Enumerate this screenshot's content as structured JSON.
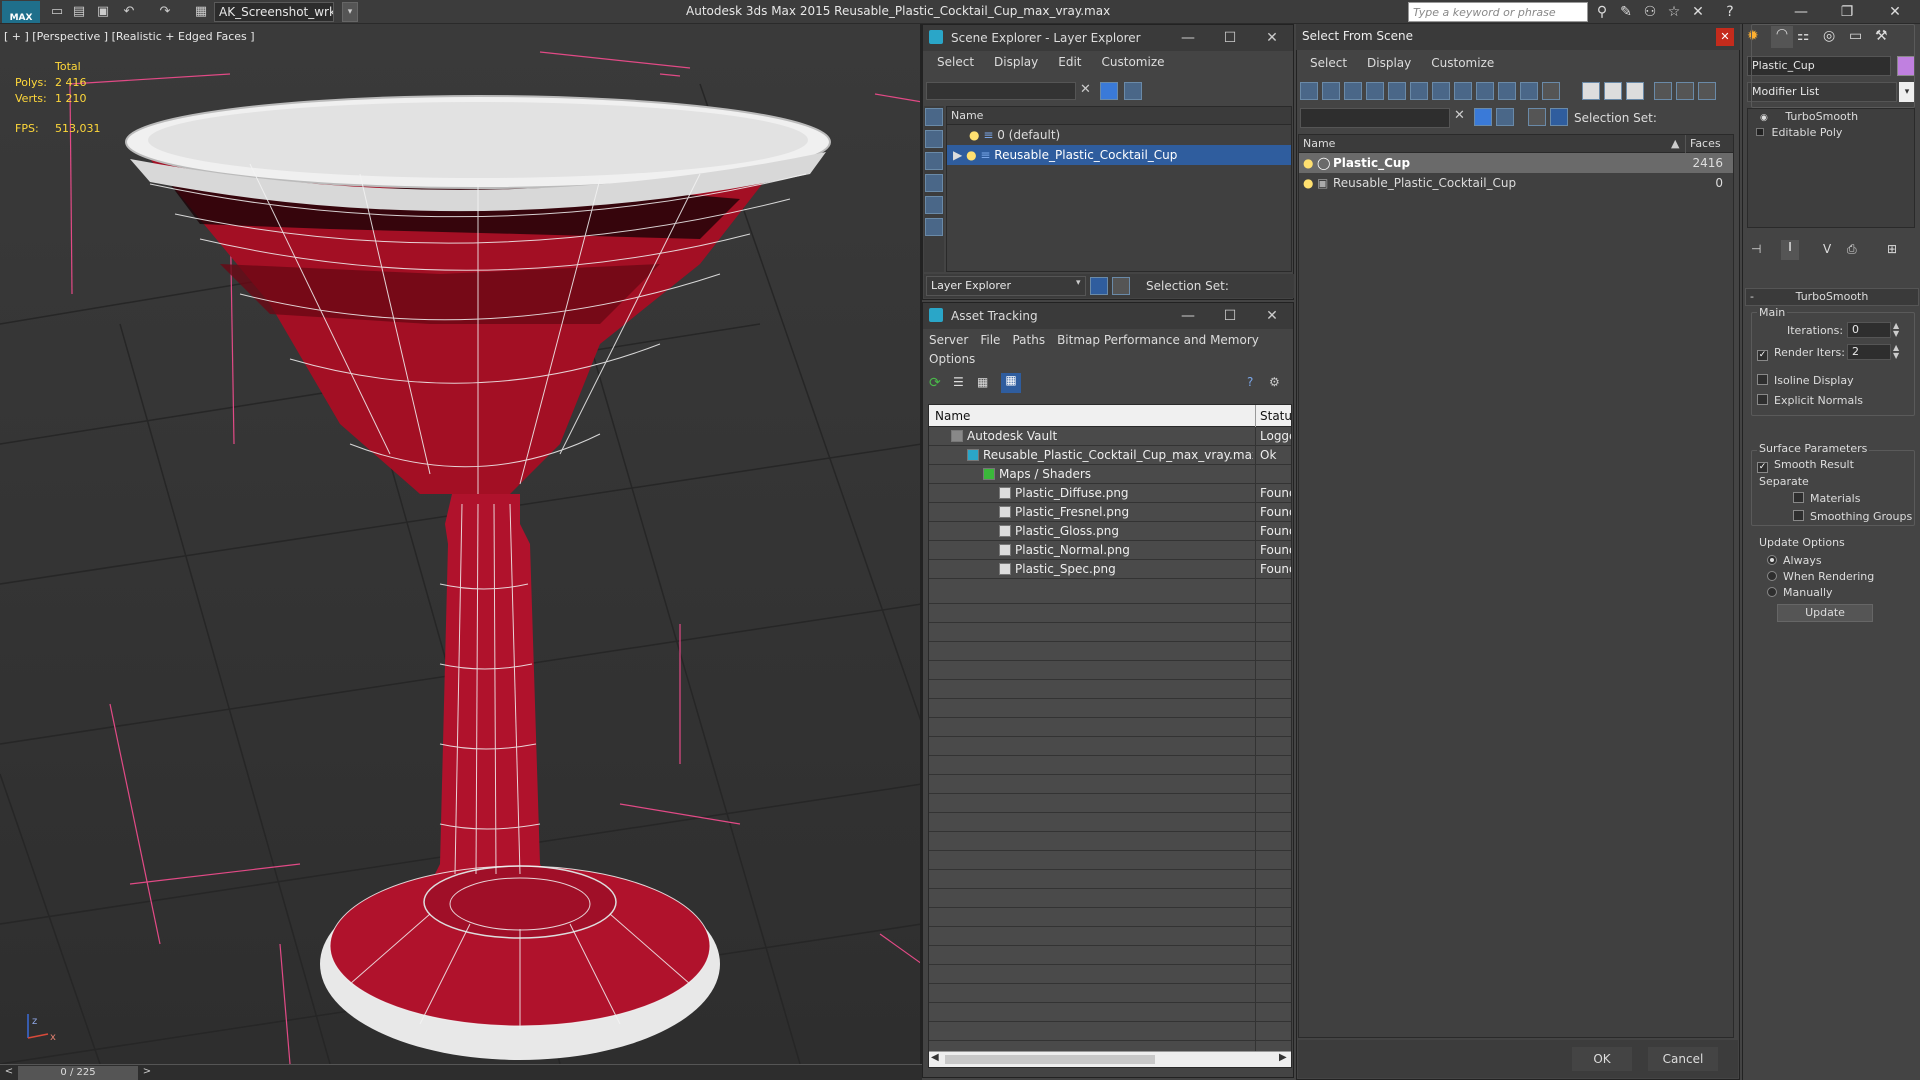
{
  "titlebar": {
    "logo": "MAX",
    "workspace": "AK_Screenshot_wrksp",
    "app_title": "Autodesk 3ds Max  2015     Reusable_Plastic_Cocktail_Cup_max_vray.max",
    "search_placeholder": "Type a keyword or phrase",
    "win_min": "—",
    "win_max": "❐",
    "win_close": "✕"
  },
  "viewport": {
    "label": "[ + ] [Perspective ] [Realistic + Edged Faces ]",
    "stats": {
      "total_label": "Total",
      "polys_label": "Polys:",
      "polys_value": "2 416",
      "verts_label": "Verts:",
      "verts_value": "1 210",
      "fps_label": "FPS:",
      "fps_value": "513,031"
    },
    "axis_x": "x",
    "axis_z": "z"
  },
  "timebar": {
    "prev": "<",
    "frame": "0 / 225",
    "next": ">"
  },
  "scene_explorer": {
    "title": "Scene Explorer - Layer Explorer",
    "menu": [
      "Select",
      "Display",
      "Edit",
      "Customize"
    ],
    "column_name": "Name",
    "rows": [
      {
        "name": "0 (default)"
      },
      {
        "name": "Reusable_Plastic_Cocktail_Cup"
      }
    ],
    "footer_mode": "Layer Explorer",
    "selection_set_label": "Selection Set:"
  },
  "asset_tracking": {
    "title": "Asset Tracking",
    "menu": [
      "Server",
      "File",
      "Paths",
      "Bitmap Performance and Memory"
    ],
    "menu2": [
      "Options"
    ],
    "columns": {
      "name": "Name",
      "status": "Status"
    },
    "rows": [
      {
        "name": "Autodesk Vault",
        "status": "Logge",
        "indent": 1
      },
      {
        "name": "Reusable_Plastic_Cocktail_Cup_max_vray.max",
        "status": "Ok",
        "indent": 2
      },
      {
        "name": "Maps / Shaders",
        "status": "",
        "indent": 3
      },
      {
        "name": "Plastic_Diffuse.png",
        "status": "Found",
        "indent": 4
      },
      {
        "name": "Plastic_Fresnel.png",
        "status": "Found",
        "indent": 4
      },
      {
        "name": "Plastic_Gloss.png",
        "status": "Found",
        "indent": 4
      },
      {
        "name": "Plastic_Normal.png",
        "status": "Found",
        "indent": 4
      },
      {
        "name": "Plastic_Spec.png",
        "status": "Found",
        "indent": 4
      }
    ]
  },
  "select_from_scene": {
    "title": "Select From Scene",
    "menu": [
      "Select",
      "Display",
      "Customize"
    ],
    "selection_set_label": "Selection Set:",
    "columns": {
      "name": "Name",
      "faces": "Faces"
    },
    "rows": [
      {
        "name": "Plastic_Cup",
        "faces": "2416"
      },
      {
        "name": "Reusable_Plastic_Cocktail_Cup",
        "faces": "0"
      }
    ],
    "ok": "OK",
    "cancel": "Cancel"
  },
  "command_panel": {
    "object_name": "Plastic_Cup",
    "modifier_list": "Modifier List",
    "stack": [
      "TurboSmooth",
      "Editable Poly"
    ],
    "rollout_title": "TurboSmooth",
    "main_label": "Main",
    "iterations_label": "Iterations:",
    "iterations_value": "0",
    "render_iters_label": "Render Iters:",
    "render_iters_value": "2",
    "isoline_label": "Isoline Display",
    "explicit_normals_label": "Explicit Normals",
    "surface_params_label": "Surface Parameters",
    "smooth_result_label": "Smooth Result",
    "separate_label": "Separate",
    "materials_label": "Materials",
    "smoothing_groups_label": "Smoothing Groups",
    "update_options_label": "Update Options",
    "always_label": "Always",
    "when_rendering_label": "When Rendering",
    "manually_label": "Manually",
    "update_button": "Update"
  }
}
